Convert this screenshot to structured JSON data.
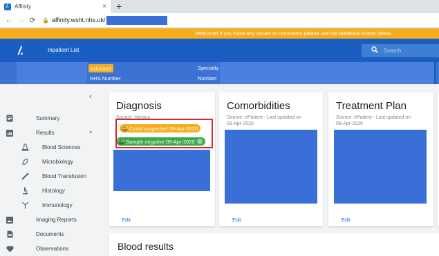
{
  "browser": {
    "tab_title": "Affinity",
    "favicon_letter": "/.",
    "url_text": "affinity.wsht.nhs.uk/"
  },
  "notice": {
    "text": "Welcome! If you have any issues or comments please use the feedback button below."
  },
  "appbar": {
    "logo": "/.",
    "title": "Inpatient List",
    "search_placeholder": "Search"
  },
  "patient": {
    "status_badge": "Admitted",
    "nhs_number_label": "NHS Number",
    "specialty_label": "Specialty",
    "number_label": "Number:"
  },
  "sidebar": {
    "items": [
      {
        "label": "Summary",
        "icon": "summary-icon"
      },
      {
        "label": "Results",
        "icon": "results-icon"
      },
      {
        "label": "Blood Sciences",
        "icon": "flask-icon"
      },
      {
        "label": "Microbiology",
        "icon": "microbe-icon"
      },
      {
        "label": "Blood Transfusion",
        "icon": "syringe-icon"
      },
      {
        "label": "Histology",
        "icon": "microscope-icon"
      },
      {
        "label": "Immunology",
        "icon": "antibody-icon"
      },
      {
        "label": "Imaging Reports",
        "icon": "image-icon"
      },
      {
        "label": "Documents",
        "icon": "document-icon"
      },
      {
        "label": "Observations",
        "icon": "heart-icon"
      }
    ]
  },
  "cards": {
    "diagnosis": {
      "title": "Diagnosis",
      "source": "Source: Various",
      "edit": "Edit",
      "chips": [
        {
          "code": "C19",
          "text": "Covid suspected 09-Apr-2020",
          "color": "#f5ad1e"
        },
        {
          "code": "C19",
          "text": "Sample negative 09-Apr-2020",
          "color": "#3ea84a"
        }
      ]
    },
    "comorbidities": {
      "title": "Comorbidities",
      "source_line1": "Source: ePatient - Last updated on",
      "source_line2": "09-Apr-2020",
      "edit": "Edit"
    },
    "treatment_plan": {
      "title": "Treatment Plan",
      "source_line1": "Source: ePatient - Last updated on",
      "source_line2": "09-Apr-2020",
      "edit": "Edit"
    },
    "blood_results": {
      "title": "Blood results"
    }
  },
  "colors": {
    "brand_blue": "#1a5ec2",
    "amber": "#f5ad1e",
    "green": "#3ea84a",
    "highlight_red": "#d9272e"
  }
}
